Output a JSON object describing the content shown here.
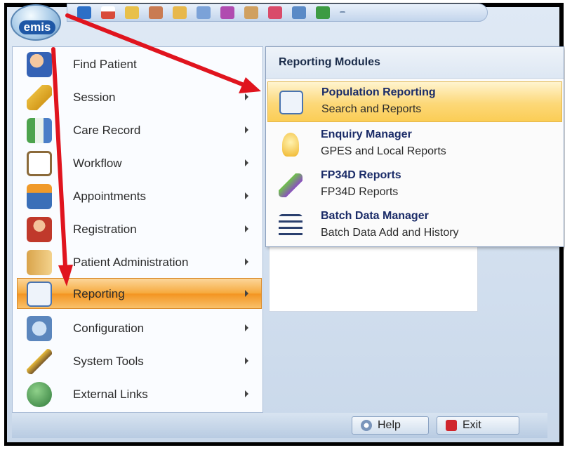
{
  "app": {
    "orb_label": "emis"
  },
  "quick_access_icons": [
    "back-arrow-icon",
    "home-icon",
    "edit-icon",
    "patient-icon",
    "folder-icon",
    "document-icon",
    "atom-icon",
    "search-icon",
    "pen-icon",
    "report-icon",
    "grid-icon",
    "dropdown-icon"
  ],
  "left_menu": {
    "items": [
      {
        "label": "Find Patient",
        "icon": "find-patient-icon",
        "has_submenu": false
      },
      {
        "label": "Session",
        "icon": "key-icon",
        "has_submenu": true
      },
      {
        "label": "Care Record",
        "icon": "care-record-icon",
        "has_submenu": true
      },
      {
        "label": "Workflow",
        "icon": "clipboard-icon",
        "has_submenu": true
      },
      {
        "label": "Appointments",
        "icon": "calendar-icon",
        "has_submenu": true
      },
      {
        "label": "Registration",
        "icon": "person-icon",
        "has_submenu": true
      },
      {
        "label": "Patient Administration",
        "icon": "cabinet-icon",
        "has_submenu": true
      },
      {
        "label": "Reporting",
        "icon": "reporting-icon",
        "has_submenu": true,
        "active": true
      },
      {
        "label": "Configuration",
        "icon": "configuration-icon",
        "has_submenu": true
      },
      {
        "label": "System Tools",
        "icon": "pencil-icon",
        "has_submenu": true
      },
      {
        "label": "External Links",
        "icon": "globe-link-icon",
        "has_submenu": true
      }
    ]
  },
  "submenu": {
    "heading": "Reporting Modules",
    "items": [
      {
        "title": "Population Reporting",
        "subtitle": "Search and Reports",
        "icon": "population-reporting-icon",
        "highlighted": true
      },
      {
        "title": "Enquiry Manager",
        "subtitle": "GPES and Local Reports",
        "icon": "lightbulb-icon"
      },
      {
        "title": "FP34D Reports",
        "subtitle": "FP34D Reports",
        "icon": "test-tube-icon"
      },
      {
        "title": "Batch Data Manager",
        "subtitle": "Batch Data Add and History",
        "icon": "batch-list-icon"
      }
    ]
  },
  "footer": {
    "help_label": "Help",
    "exit_label": "Exit"
  },
  "colors": {
    "accent": "#f39420",
    "highlight": "#fcd878",
    "annotation_arrow": "#e0141e"
  }
}
